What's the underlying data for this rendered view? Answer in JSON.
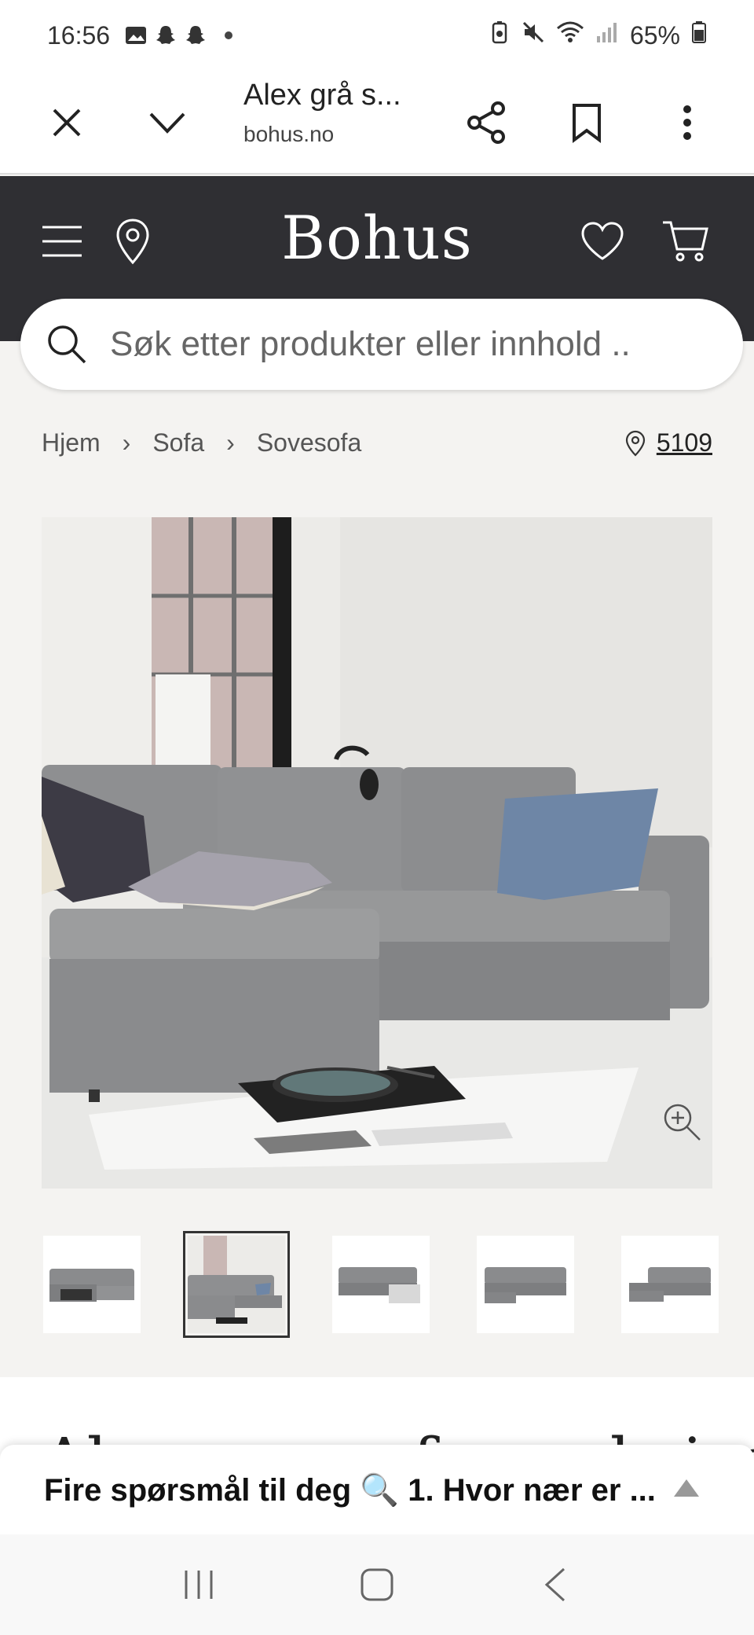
{
  "status": {
    "time": "16:56",
    "battery": "65%"
  },
  "browser": {
    "title": "Alex grå s...",
    "domain": "bohus.no"
  },
  "site": {
    "logo": "Bohus"
  },
  "search": {
    "placeholder": "Søk etter produkter eller innhold .."
  },
  "breadcrumb": {
    "items": [
      "Hjem",
      "Sofa",
      "Sovesofa"
    ],
    "separator": "›"
  },
  "store": {
    "code": "5109"
  },
  "product": {
    "title_partial": "Alex sovesofa med sjeselong"
  },
  "thumbnails": {
    "count": 5,
    "active_index": 1
  },
  "chat": {
    "text": "Fire spørsmål til deg 🔍 1. Hvor nær er ..."
  },
  "colors": {
    "header": "#2f2f33",
    "background": "#f4f3f1",
    "sofa": "#8a8b8d",
    "pillow_blue": "#6e86a6"
  }
}
